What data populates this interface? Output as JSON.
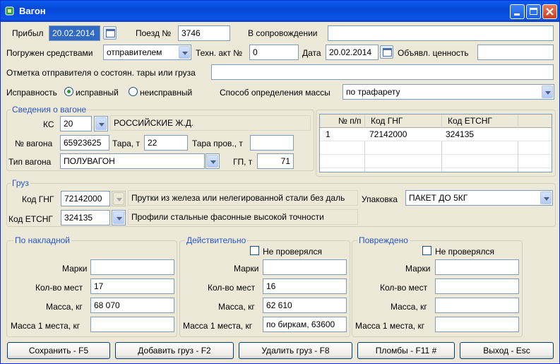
{
  "window": {
    "title": "Вагон"
  },
  "top": {
    "arrived_label": "Прибыл",
    "arrived_value": "20.02.2014",
    "train_label": "Поезд №",
    "train_value": "3746",
    "escort_label": "В сопровождении",
    "escort_value": "",
    "loaded_by_label": "Погружен средствами",
    "loaded_by_value": "отправителем",
    "tech_act_label": "Техн. акт №",
    "tech_act_value": "0",
    "date_label": "Дата",
    "date_value": "20.02.2014",
    "declared_value_label": "Объявл. ценность",
    "declared_value_value": "",
    "note_label": "Отметка отправителя о состоян. тары или груза",
    "note_value": "",
    "condition_label": "Исправность",
    "condition_ok": "исправный",
    "condition_bad": "неисправный",
    "mass_method_label": "Способ определения массы",
    "mass_method_value": "по трафарету"
  },
  "wagon": {
    "group_title": "Сведения о вагоне",
    "ks_label": "КС",
    "ks_value": "20",
    "ks_name": "РОССИЙСКИЕ Ж.Д.",
    "number_label": "№ вагона",
    "number_value": "65923625",
    "tare_label": "Тара, т",
    "tare_value": "22",
    "tare_checked_label": "Тара пров., т",
    "tare_checked_value": "",
    "type_label": "Тип вагона",
    "type_value": "ПОЛУВАГОН",
    "gp_label": "ГП, т",
    "gp_value": "71"
  },
  "grid": {
    "columns": [
      "№ п/п",
      "Код ГНГ",
      "Код ЕТСНГ"
    ],
    "rows": [
      [
        "1",
        "72142000",
        "324135"
      ]
    ]
  },
  "cargo": {
    "group_title": "Груз",
    "gng_label": "Код ГНГ",
    "gng_value": "72142000",
    "gng_name": "Прутки из железа или нелегированной стали без даль",
    "packing_label": "Упаковка",
    "packing_value": "ПАКЕТ ДО 5КГ",
    "etsng_label": "Код ЕТСНГ",
    "etsng_value": "324135",
    "etsng_name": "Профили стальные фасонные высокой точности"
  },
  "invoice": {
    "group_title": "По накладной",
    "marks_label": "Марки",
    "marks_value": "",
    "places_label": "Кол-во мест",
    "places_value": "17",
    "mass_label": "Масса, кг",
    "mass_value": "68 070",
    "mass_one_label": "Масса 1 места, кг",
    "mass_one_value": ""
  },
  "actual": {
    "group_title": "Действительно",
    "not_checked_label": "Не проверялся",
    "marks_label": "Марки",
    "marks_value": "",
    "places_label": "Кол-во мест",
    "places_value": "16",
    "mass_label": "Масса, кг",
    "mass_value": "62 610",
    "mass_one_label": "Масса 1 места, кг",
    "mass_one_value": "по биркам, 63600"
  },
  "damaged": {
    "group_title": "Повреждено",
    "not_checked_label": "Не проверялся",
    "marks_label": "Марки",
    "marks_value": "",
    "places_label": "Кол-во мест",
    "places_value": "",
    "mass_label": "Масса, кг",
    "mass_value": "",
    "mass_one_label": "Масса 1 места, кг",
    "mass_one_value": ""
  },
  "buttons": {
    "save": "Сохранить - F5",
    "add_cargo": "Добавить груз - F2",
    "delete_cargo": "Удалить груз - F8",
    "seals": "Пломбы - F11 #",
    "exit": "Выход - Esc"
  }
}
